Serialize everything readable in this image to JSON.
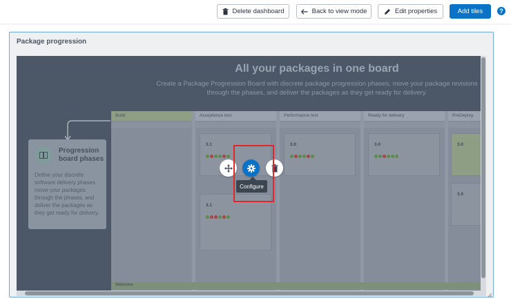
{
  "toolbar": {
    "delete_label": "Delete dashboard",
    "back_label": "Back to view mode",
    "edit_label": "Edit properties",
    "add_label": "Add tiles",
    "help_label": "?"
  },
  "tile": {
    "title": "Package progression",
    "hero_title": "All your packages in one board",
    "hero_subtitle": "Create a Package Progression Board with discrete package progression phases, move your package revisions through the phases, and deliver the packages as they get ready for delivery.",
    "phases_heading": "Progression board phases",
    "phases_text": "Define your discrete software delivery phases, move your packages through the phases, and deliver the packages as they get ready for delivery.",
    "columns": [
      "Build",
      "Acceptance test",
      "Performance test",
      "Ready for delivery",
      "PreDeploy"
    ],
    "card_versions": [
      "3.1",
      "3.1",
      "3.0",
      "3.0",
      "3.0",
      "3.0"
    ],
    "row_label": "Webstore"
  },
  "overlay": {
    "tooltip": "Configure"
  },
  "colors": {
    "accent": "#0a73c7",
    "highlight": "#e3242b"
  }
}
